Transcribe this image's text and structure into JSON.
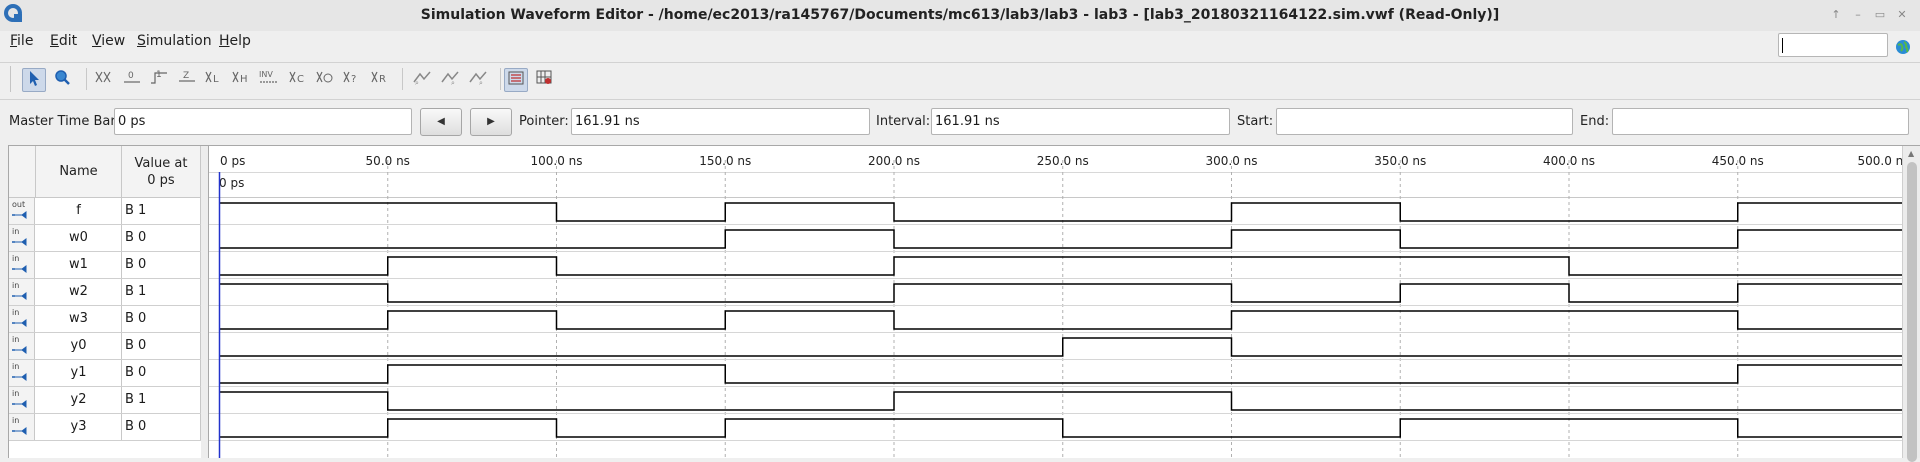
{
  "window": {
    "title": "Simulation Waveform Editor - /home/ec2013/ra145767/Documents/mc613/lab3/lab3 - lab3 - [lab3_20180321164122.sim.vwf (Read-Only)]",
    "controls": [
      "↑",
      "–",
      "▭",
      "✕"
    ]
  },
  "menu": [
    {
      "key": "F",
      "rest": "ile"
    },
    {
      "key": "E",
      "rest": "dit"
    },
    {
      "key": "V",
      "rest": "iew"
    },
    {
      "key": "S",
      "rest": "imulation"
    },
    {
      "key": "H",
      "rest": "elp"
    }
  ],
  "toolbar": {
    "tool_icons": [
      "select-arrow-icon",
      "zoom-icon",
      "force-unknown-icon",
      "force-low-icon",
      "force-high-icon",
      "force-z-icon",
      "force-weak-low-icon",
      "force-weak-high-icon",
      "invert-icon",
      "count-value-icon",
      "clock-icon",
      "random-value-icon",
      "force-dont-care-icon",
      "arbitrary-value-icon",
      "run-functional-icon",
      "run-timing-icon",
      "run-timing-netlist-icon",
      "snap-grid-icon",
      "grid-settings-icon"
    ],
    "inv_label": "INV",
    "glyphs": [
      "⌕",
      "⌕",
      "⌕"
    ]
  },
  "timebar": {
    "master_label": "Master Time Bar:",
    "master_value": "0 ps",
    "prev_glyph": "◀",
    "next_glyph": "▶",
    "pointer_label": "Pointer:",
    "pointer_value": "161.91 ns",
    "interval_label": "Interval:",
    "interval_value": "161.91 ns",
    "start_label": "Start:",
    "start_value": "",
    "end_label": "End:",
    "end_value": ""
  },
  "table": {
    "name_header": "Name",
    "value_header_line1": "Value at",
    "value_header_line2": "0 ps"
  },
  "timeline": {
    "cursor_label": "0 ps",
    "ticks": [
      "0 ps",
      "50.0 ns",
      "100.0 ns",
      "150.0 ns",
      "200.0 ns",
      "250.0 ns",
      "300.0 ns",
      "350.0 ns",
      "400.0 ns",
      "450.0 ns",
      "500.0 ns"
    ],
    "tick_times_ns": [
      0,
      50,
      100,
      150,
      200,
      250,
      300,
      350,
      400,
      450,
      500
    ]
  },
  "signals": [
    {
      "name": "f",
      "value": "B 1",
      "dir": "out",
      "transitions_ns": [
        0,
        100,
        150,
        200,
        300,
        350,
        450
      ],
      "init": 1
    },
    {
      "name": "w0",
      "value": "B 0",
      "dir": "in",
      "transitions_ns": [
        0,
        150,
        200,
        300,
        350,
        450
      ],
      "init": 0
    },
    {
      "name": "w1",
      "value": "B 0",
      "dir": "in",
      "transitions_ns": [
        0,
        50,
        100,
        200,
        400
      ],
      "init": 0
    },
    {
      "name": "w2",
      "value": "B 1",
      "dir": "in",
      "transitions_ns": [
        0,
        50,
        200,
        300,
        350,
        400,
        450
      ],
      "init": 1
    },
    {
      "name": "w3",
      "value": "B 0",
      "dir": "in",
      "transitions_ns": [
        0,
        50,
        100,
        150,
        200,
        300,
        450
      ],
      "init": 0
    },
    {
      "name": "y0",
      "value": "B 0",
      "dir": "in",
      "transitions_ns": [
        0,
        250,
        300
      ],
      "init": 0
    },
    {
      "name": "y1",
      "value": "B 0",
      "dir": "in",
      "transitions_ns": [
        0,
        50,
        150,
        450
      ],
      "init": 0
    },
    {
      "name": "y2",
      "value": "B 1",
      "dir": "in",
      "transitions_ns": [
        0,
        50,
        200,
        300
      ],
      "init": 1
    },
    {
      "name": "y3",
      "value": "B 0",
      "dir": "in",
      "transitions_ns": [
        0,
        50,
        100,
        150,
        250,
        350,
        450
      ],
      "init": 0
    }
  ],
  "colors": {
    "wave": "#000000",
    "cursor": "#2233cc",
    "grid": "#b0b0b0",
    "globe": "#2a8cd4"
  }
}
